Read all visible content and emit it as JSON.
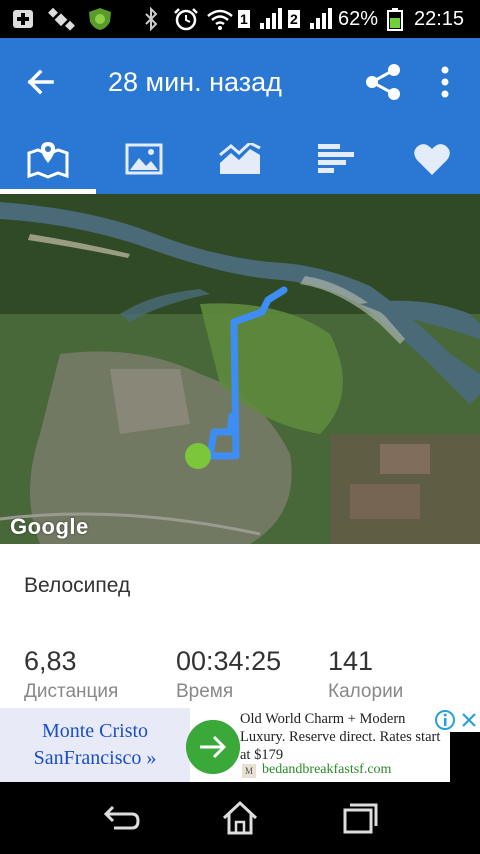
{
  "status_bar": {
    "sim1": "1",
    "sim2": "2",
    "battery": "62%",
    "time": "22:15"
  },
  "app_bar": {
    "title": "28 мин. назад",
    "back_icon": "arrow-back-icon",
    "share_icon": "share-icon",
    "more_icon": "more-vert-icon",
    "color": "#2a78d4"
  },
  "tabs": [
    {
      "icon": "map-icon",
      "selected": true
    },
    {
      "icon": "photo-icon",
      "selected": false
    },
    {
      "icon": "chart-icon",
      "selected": false
    },
    {
      "icon": "splits-icon",
      "selected": false
    },
    {
      "icon": "heart-icon",
      "selected": false
    }
  ],
  "map": {
    "attribution": "Google",
    "route_color": "#3d8df5",
    "start_marker_color": "#7cc63c"
  },
  "activity": {
    "type": "Велосипед",
    "stats": [
      {
        "value": "6,83",
        "label": "Дистанция"
      },
      {
        "value": "00:34:25",
        "label": "Время"
      },
      {
        "value": "141",
        "label": "Калории"
      }
    ]
  },
  "ad": {
    "left_line1": "Monte Cristo",
    "left_line2": "SanFrancisco »",
    "text": "Old World Charm + Modern Luxury. Reserve direct. Rates start at $179",
    "favicon": "M",
    "domain": "bedandbreakfastsf.com"
  },
  "nav_bar": {
    "back_icon": "nav-back-icon",
    "home_icon": "nav-home-icon",
    "recents_icon": "nav-recents-icon"
  }
}
